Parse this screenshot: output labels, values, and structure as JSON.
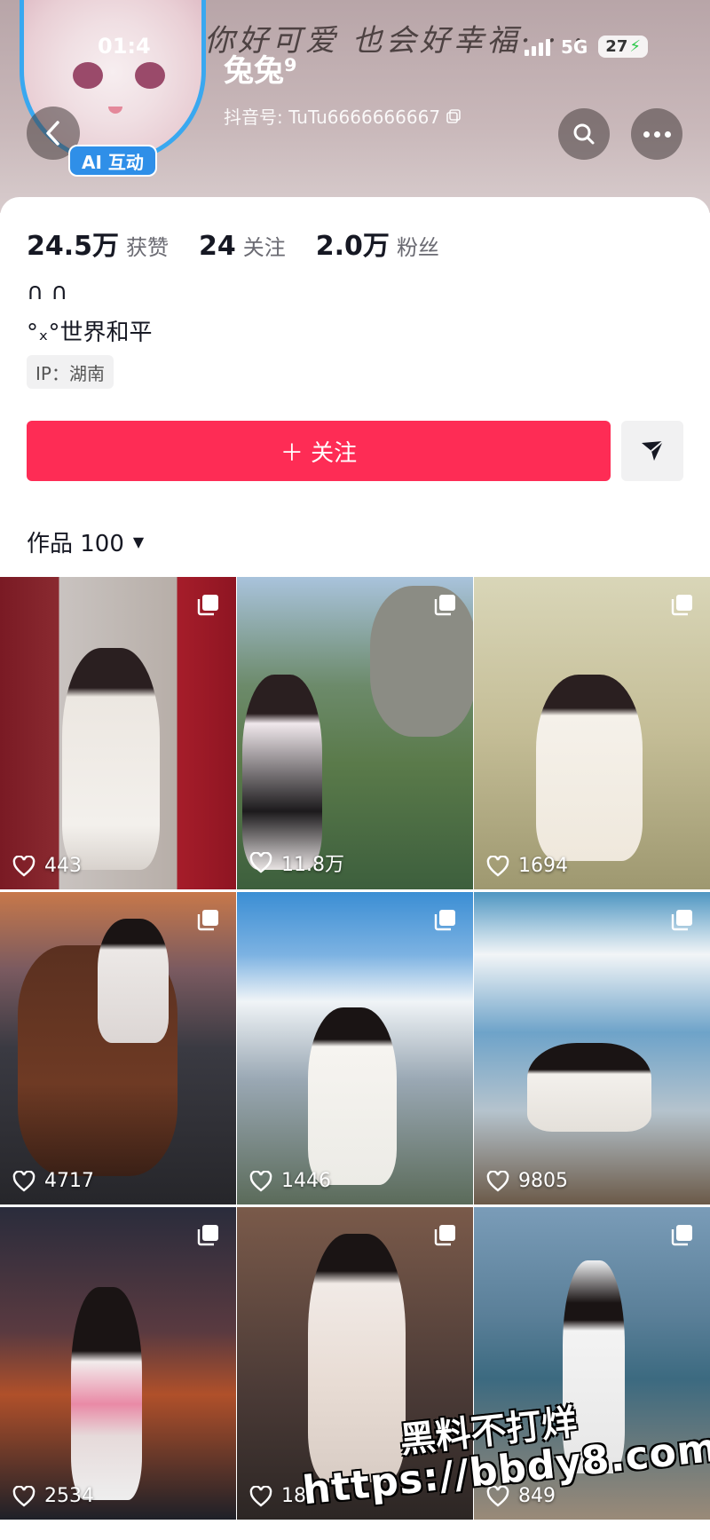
{
  "status_bar": {
    "time": "01:4",
    "network": "5G",
    "battery": "27"
  },
  "header": {
    "handwriting": "你好可爱 也会好幸福· · ·",
    "nickname": "兔兔⁹",
    "douyin_id": "抖音号: TuTu6666666667",
    "ai_badge": "AI 互动"
  },
  "profile": {
    "stats": [
      {
        "value": "24.5万",
        "label": "获赞"
      },
      {
        "value": "24",
        "label": "关注"
      },
      {
        "value": "2.0万",
        "label": "粉丝"
      }
    ],
    "bio_line1": "∩ ∩",
    "bio_line2": "°ₓ°世界和平",
    "ip": "IP：湖南",
    "follow_label": "＋ 关注",
    "works_tab": "作品 100"
  },
  "works": [
    {
      "likes": "443"
    },
    {
      "likes": "11.8万"
    },
    {
      "likes": "1694"
    },
    {
      "likes": "4717"
    },
    {
      "likes": "1446"
    },
    {
      "likes": "9805"
    },
    {
      "likes": "2534"
    },
    {
      "likes": "18"
    },
    {
      "likes": "849"
    }
  ],
  "watermark": {
    "line1": "黑料不打烊",
    "line2": "https://bbdy8.com"
  },
  "colors": {
    "follow": "#fe2c55",
    "avatar_ring": "#39a8f0",
    "ai_badge": "#2f8fe8"
  }
}
